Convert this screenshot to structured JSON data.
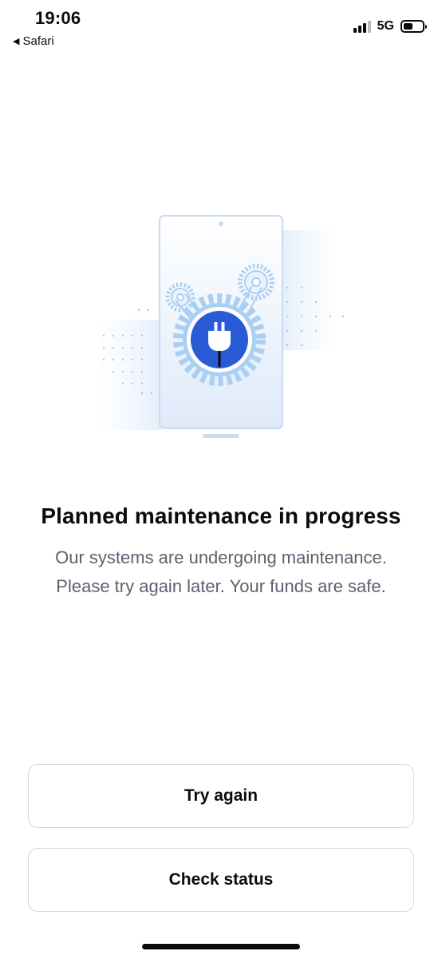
{
  "status_bar": {
    "time": "19:06",
    "back_app": "Safari",
    "network": "5G"
  },
  "illustration": {
    "icon": "plug-icon",
    "accent": "#2a5bd7"
  },
  "content": {
    "title": "Planned maintenance in progress",
    "message_line1": "Our systems are undergoing maintenance.",
    "message_line2": "Please try again later. Your funds are safe."
  },
  "actions": {
    "try_again_label": "Try again",
    "check_status_label": "Check status"
  }
}
